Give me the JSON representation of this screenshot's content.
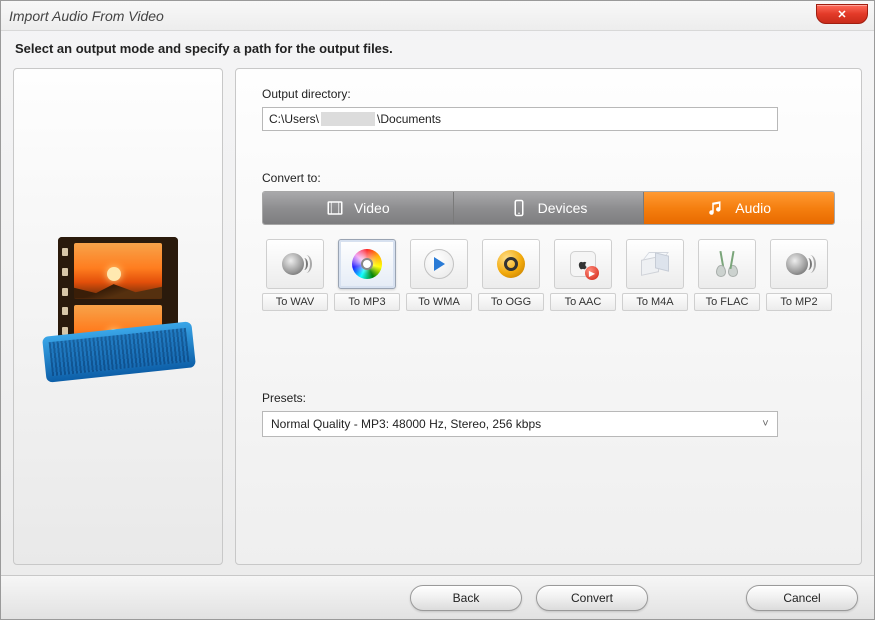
{
  "window": {
    "title": "Import Audio From Video"
  },
  "instruction": "Select an output mode and specify a path for the output files.",
  "output": {
    "label": "Output directory:",
    "path_prefix": "C:\\Users\\",
    "path_suffix": "\\Documents"
  },
  "convert": {
    "label": "Convert to:",
    "tabs": [
      {
        "id": "video",
        "label": "Video",
        "active": false
      },
      {
        "id": "devices",
        "label": "Devices",
        "active": false
      },
      {
        "id": "audio",
        "label": "Audio",
        "active": true
      }
    ],
    "formats": [
      {
        "id": "wav",
        "label": "To WAV",
        "selected": false
      },
      {
        "id": "mp3",
        "label": "To MP3",
        "selected": true
      },
      {
        "id": "wma",
        "label": "To WMA",
        "selected": false
      },
      {
        "id": "ogg",
        "label": "To OGG",
        "selected": false
      },
      {
        "id": "aac",
        "label": "To AAC",
        "selected": false
      },
      {
        "id": "m4a",
        "label": "To M4A",
        "selected": false
      },
      {
        "id": "flac",
        "label": "To FLAC",
        "selected": false
      },
      {
        "id": "mp2",
        "label": "To MP2",
        "selected": false
      }
    ]
  },
  "presets": {
    "label": "Presets:",
    "value": "Normal Quality - MP3: 48000 Hz, Stereo, 256 kbps"
  },
  "footer": {
    "back": "Back",
    "convert": "Convert",
    "cancel": "Cancel"
  }
}
